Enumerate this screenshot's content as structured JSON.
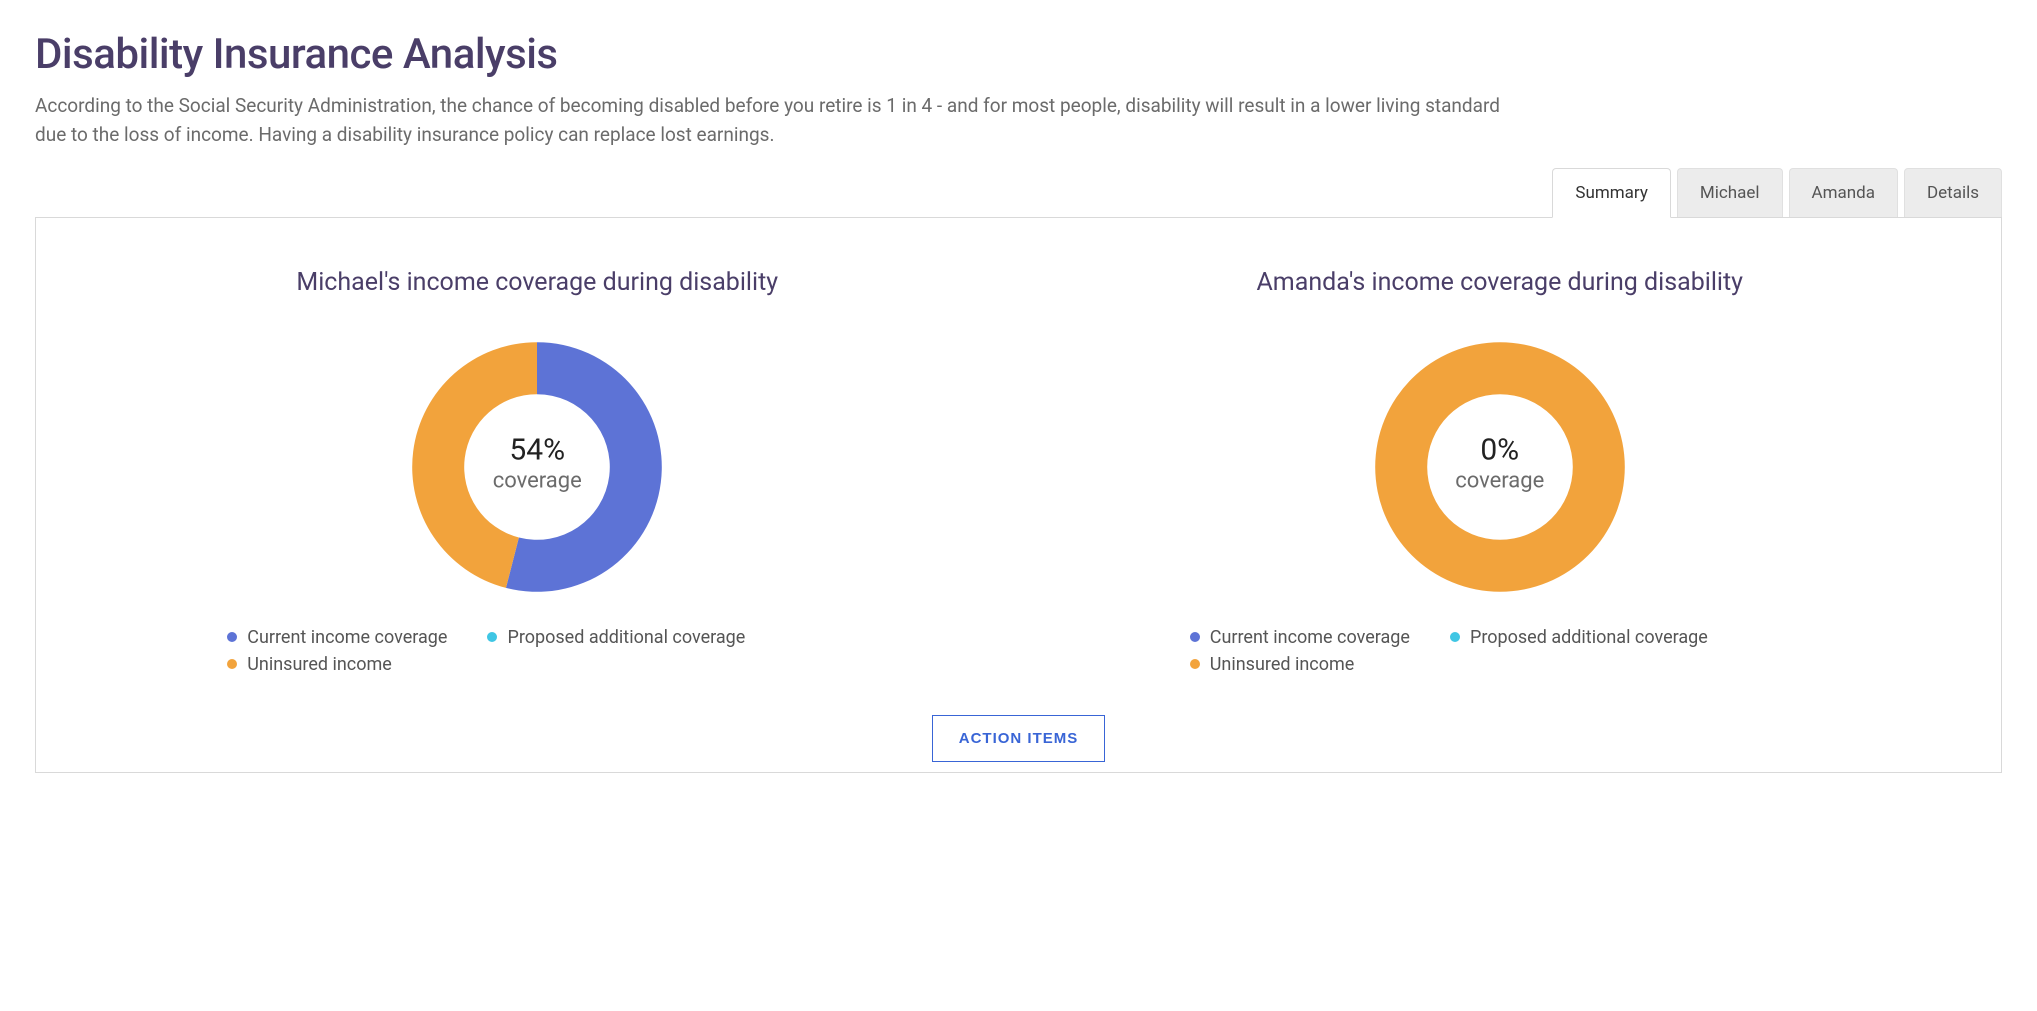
{
  "header": {
    "title": "Disability Insurance Analysis",
    "description": "According to the Social Security Administration, the chance of becoming disabled before you retire is 1 in 4 - and for most people, disability will result in a lower living standard due to the loss of income. Having a disability insurance policy can replace lost earnings."
  },
  "tabs": [
    {
      "label": "Summary",
      "active": true
    },
    {
      "label": "Michael",
      "active": false
    },
    {
      "label": "Amanda",
      "active": false
    },
    {
      "label": "Details",
      "active": false
    }
  ],
  "colors": {
    "current": "#5d73d6",
    "proposed": "#3fc6e4",
    "uninsured": "#f2a33c"
  },
  "legend_labels": {
    "current": "Current income coverage",
    "proposed": "Proposed additional coverage",
    "uninsured": "Uninsured income"
  },
  "charts": [
    {
      "id": "michael",
      "title": "Michael's income coverage during disability",
      "center_pct": "54%",
      "center_label": "coverage",
      "slices": {
        "current": 54,
        "proposed": 0,
        "uninsured": 46
      }
    },
    {
      "id": "amanda",
      "title": "Amanda's income coverage during disability",
      "center_pct": "0%",
      "center_label": "coverage",
      "slices": {
        "current": 0,
        "proposed": 0,
        "uninsured": 100
      }
    }
  ],
  "action_button": "ACTION ITEMS",
  "chart_data": [
    {
      "type": "pie",
      "title": "Michael's income coverage during disability",
      "series": [
        {
          "name": "Current income coverage",
          "value": 54,
          "color": "#5d73d6"
        },
        {
          "name": "Proposed additional coverage",
          "value": 0,
          "color": "#3fc6e4"
        },
        {
          "name": "Uninsured income",
          "value": 46,
          "color": "#f2a33c"
        }
      ],
      "center_annotation": "54% coverage"
    },
    {
      "type": "pie",
      "title": "Amanda's income coverage during disability",
      "series": [
        {
          "name": "Current income coverage",
          "value": 0,
          "color": "#5d73d6"
        },
        {
          "name": "Proposed additional coverage",
          "value": 0,
          "color": "#3fc6e4"
        },
        {
          "name": "Uninsured income",
          "value": 100,
          "color": "#f2a33c"
        }
      ],
      "center_annotation": "0% coverage"
    }
  ]
}
